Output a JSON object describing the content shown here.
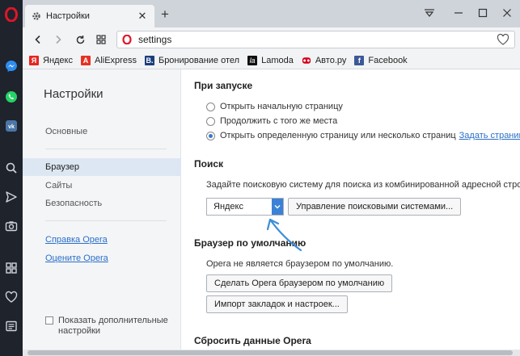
{
  "tab": {
    "title": "Настройки"
  },
  "address": {
    "url": "settings"
  },
  "bookmarks": [
    {
      "label": "Яндекс",
      "icon": "yandex-icon",
      "color": "#e52620",
      "glyph": "Я"
    },
    {
      "label": "AliExpress",
      "icon": "aliexpress-icon",
      "color": "#e43225",
      "glyph": "A"
    },
    {
      "label": "Бронирование отел",
      "icon": "booking-icon",
      "color": "#1c3f7a",
      "glyph": "B."
    },
    {
      "label": "Lamoda",
      "icon": "lamoda-icon",
      "color": "#111111",
      "glyph": "la"
    },
    {
      "label": "Авто.ру",
      "icon": "autoru-icon",
      "color": "#d6001c",
      "glyph": ""
    },
    {
      "label": "Facebook",
      "icon": "facebook-icon",
      "color": "#3b5998",
      "glyph": "f"
    }
  ],
  "nav": {
    "title": "Настройки",
    "items": [
      "Основные",
      "Браузер",
      "Сайты",
      "Безопасность"
    ],
    "active": "Браузер",
    "links": [
      "Справка Opera",
      "Оцените Opera"
    ],
    "advanced_label": "Показать дополнительные настройки"
  },
  "startup": {
    "title": "При запуске",
    "options": [
      "Открыть начальную страницу",
      "Продолжить с того же места",
      "Открыть определенную страницу или несколько страниц"
    ],
    "selected_index": 2,
    "link": "Задать страницы"
  },
  "search": {
    "title": "Поиск",
    "description": "Задайте поисковую систему для поиска из комбинированной адресной строки",
    "engine": "Яндекс",
    "manage_button": "Управление поисковыми системами..."
  },
  "default_browser": {
    "title": "Браузер по умолчанию",
    "status": "Opera не является браузером по умолчанию.",
    "make_default_button": "Сделать Opera браузером по умолчанию",
    "import_button": "Импорт закладок и настроек..."
  },
  "reset": {
    "title": "Сбросить данные Opera"
  },
  "colors": {
    "sidebar": "#1f232b",
    "accent": "#3b82d6",
    "link": "#2a6fc9",
    "opera_red": "#e0162b",
    "annotation_arrow": "#3b8ed8"
  }
}
